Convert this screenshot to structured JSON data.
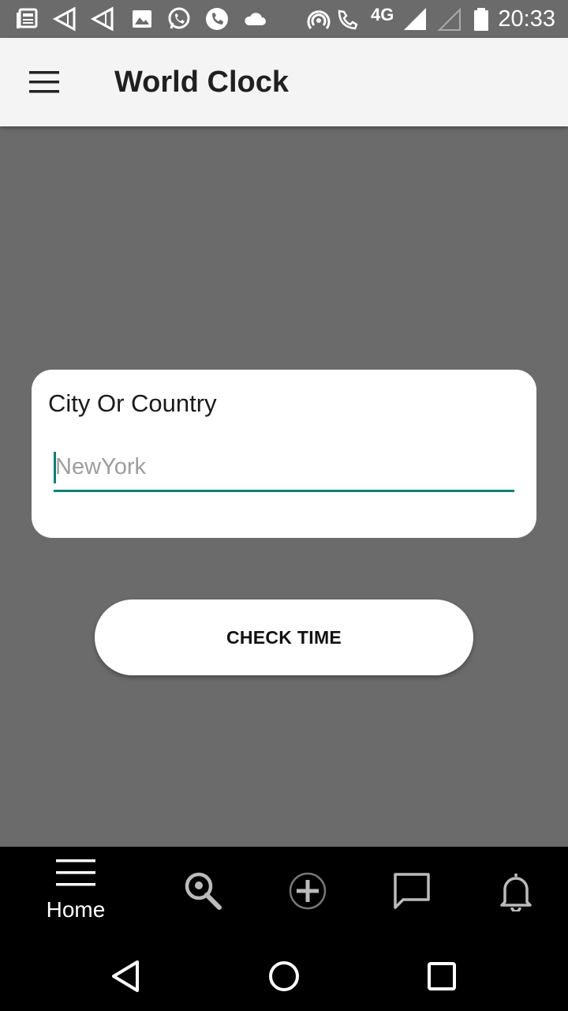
{
  "status_bar": {
    "time": "20:33",
    "network": "4G",
    "icons": [
      "news-icon",
      "cast-icon",
      "cast-icon",
      "image-icon",
      "whatsapp-icon",
      "phone-icon",
      "cloud-icon",
      "hotspot-icon",
      "volte-call-icon",
      "signal-icon",
      "signal-empty-icon",
      "battery-icon"
    ]
  },
  "app_bar": {
    "title": "World Clock",
    "menu_icon": "hamburger-menu-icon"
  },
  "form": {
    "label": "City Or Country",
    "input_value": "",
    "input_placeholder": "NewYork",
    "accent_color": "#127f71"
  },
  "check_button": {
    "label": "CHECK TIME"
  },
  "bottom_nav": {
    "items": [
      {
        "label": "Home",
        "icon": "hamburger-icon",
        "active": true
      },
      {
        "label": "",
        "icon": "location-search-icon",
        "active": false
      },
      {
        "label": "",
        "icon": "add-circle-icon",
        "active": false
      },
      {
        "label": "",
        "icon": "chat-bubble-icon",
        "active": false
      },
      {
        "label": "",
        "icon": "bell-icon",
        "active": false
      }
    ]
  },
  "system_nav": {
    "buttons": [
      "back-icon",
      "home-circle-icon",
      "recents-square-icon"
    ]
  },
  "colors": {
    "background": "#6b6b6b",
    "app_bar": "#f4f4f4",
    "nav_bar": "#000000"
  }
}
